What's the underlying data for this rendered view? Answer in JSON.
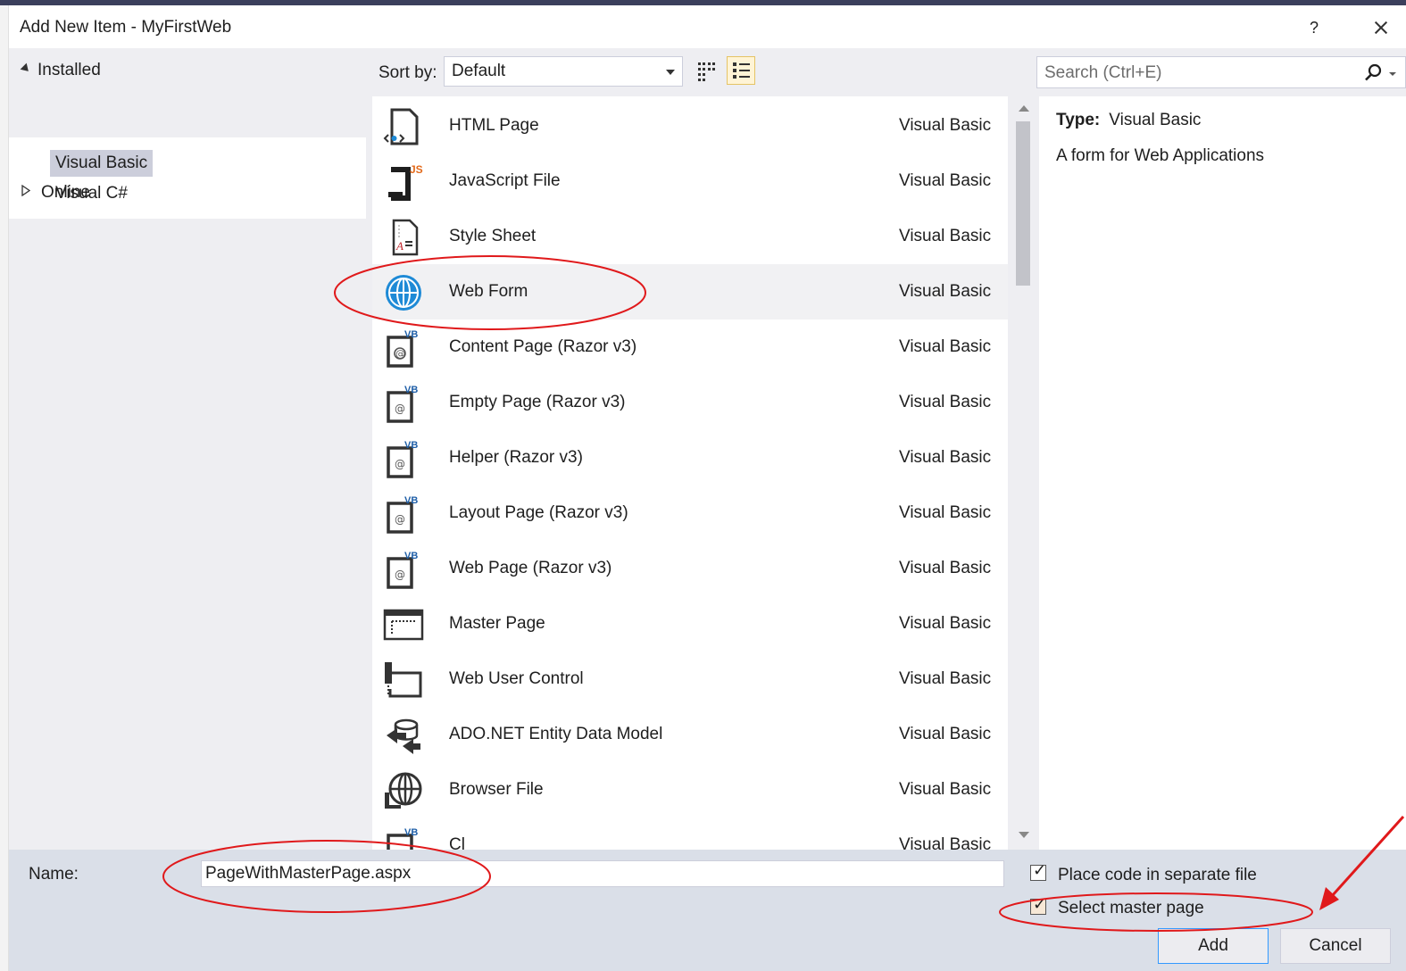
{
  "window": {
    "title": "Add New Item - MyFirstWeb",
    "help_label": "?"
  },
  "tree": {
    "installed_label": "Installed",
    "children": [
      "Visual Basic",
      "Visual C#"
    ],
    "online_label": "Online"
  },
  "toolbar": {
    "sort_label": "Sort by:",
    "sort_value": "Default"
  },
  "search": {
    "placeholder": "Search (Ctrl+E)"
  },
  "templates": [
    {
      "name": "HTML Page",
      "lang": "Visual Basic",
      "icon": "html-page-icon"
    },
    {
      "name": "JavaScript File",
      "lang": "Visual Basic",
      "icon": "javascript-file-icon"
    },
    {
      "name": "Style Sheet",
      "lang": "Visual Basic",
      "icon": "style-sheet-icon"
    },
    {
      "name": "Web Form",
      "lang": "Visual Basic",
      "icon": "globe-icon"
    },
    {
      "name": "Content Page (Razor v3)",
      "lang": "Visual Basic",
      "icon": "razor-page-icon"
    },
    {
      "name": "Empty Page (Razor v3)",
      "lang": "Visual Basic",
      "icon": "razor-page-icon"
    },
    {
      "name": "Helper (Razor v3)",
      "lang": "Visual Basic",
      "icon": "razor-page-icon"
    },
    {
      "name": "Layout Page (Razor v3)",
      "lang": "Visual Basic",
      "icon": "razor-page-icon"
    },
    {
      "name": "Web Page (Razor v3)",
      "lang": "Visual Basic",
      "icon": "razor-page-icon"
    },
    {
      "name": "Master Page",
      "lang": "Visual Basic",
      "icon": "master-page-icon"
    },
    {
      "name": "Web User Control",
      "lang": "Visual Basic",
      "icon": "user-control-icon"
    },
    {
      "name": "ADO.NET Entity Data Model",
      "lang": "Visual Basic",
      "icon": "entity-model-icon"
    },
    {
      "name": "Browser File",
      "lang": "Visual Basic",
      "icon": "browser-file-icon"
    },
    {
      "name": "Cl",
      "lang": "Visual Basic",
      "icon": "razor-page-icon"
    }
  ],
  "details": {
    "type_label": "Type:",
    "type_value": "Visual Basic",
    "description": "A form for Web Applications"
  },
  "bottom": {
    "name_label": "Name:",
    "name_value": "PageWithMasterPage.aspx",
    "separate_file_label": "Place code in separate file",
    "master_page_label": "Select master page",
    "add_label": "Add",
    "cancel_label": "Cancel"
  },
  "colors": {
    "annotation": "#e0191b",
    "selection": "#cccedb",
    "accent": "#007acc"
  }
}
